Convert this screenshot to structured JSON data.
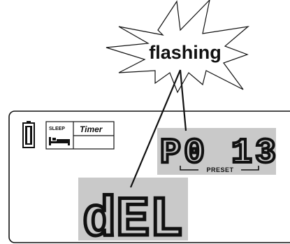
{
  "callout": {
    "label": "flashing"
  },
  "display": {
    "sleep_label": "SLEEP",
    "timer_label": "Timer",
    "preset_readout": "P0 13",
    "preset_label": "PRESET",
    "main_readout": "dEL"
  },
  "colors": {
    "segment_background": "#c9c9c9",
    "segment_ink": "#111111",
    "outline": "#111111"
  },
  "icons": [
    "battery-icon",
    "bed-icon"
  ]
}
